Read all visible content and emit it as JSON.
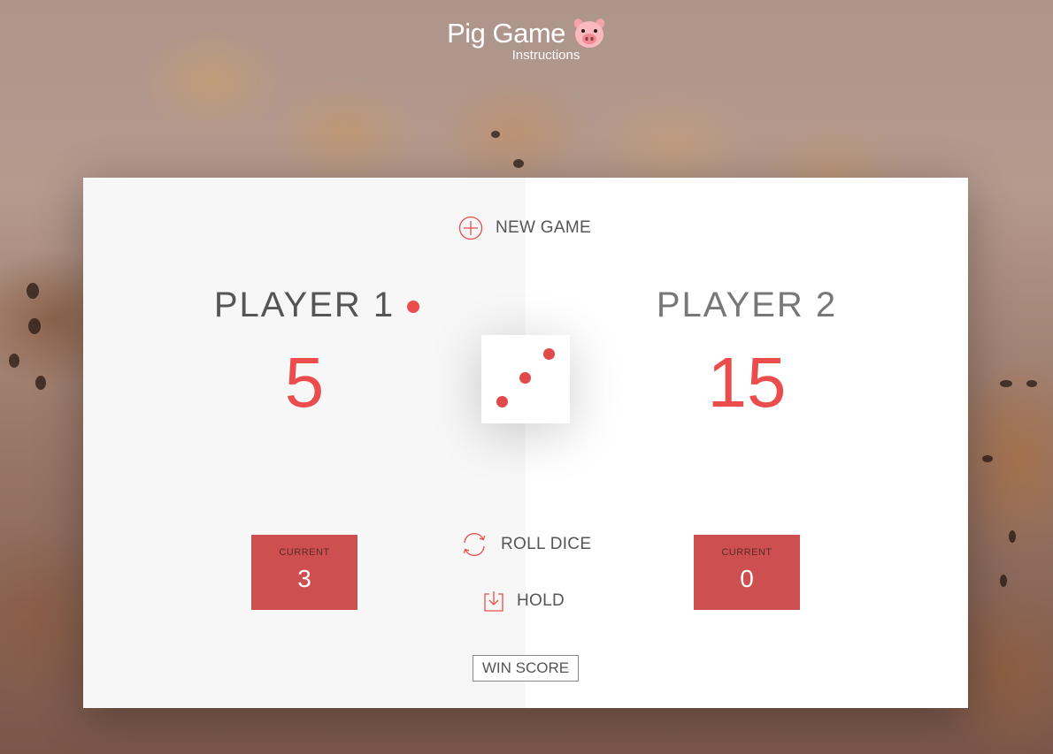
{
  "header": {
    "title": "Pig Game",
    "emoji": "pig-face-icon",
    "instructions": "Instructions"
  },
  "controls": {
    "new_game": "NEW GAME",
    "roll_dice": "ROLL DICE",
    "hold": "HOLD",
    "win_score": "WIN SCORE"
  },
  "players": [
    {
      "name": "PLAYER 1",
      "score": "5",
      "current_label": "CURRENT",
      "current": "3",
      "active": true
    },
    {
      "name": "PLAYER 2",
      "score": "15",
      "current_label": "CURRENT",
      "current": "0",
      "active": false
    }
  ],
  "dice": {
    "value": 3
  },
  "colors": {
    "accent": "#EB4D4D",
    "current_box": "#CD4F4F",
    "text": "#555555"
  }
}
